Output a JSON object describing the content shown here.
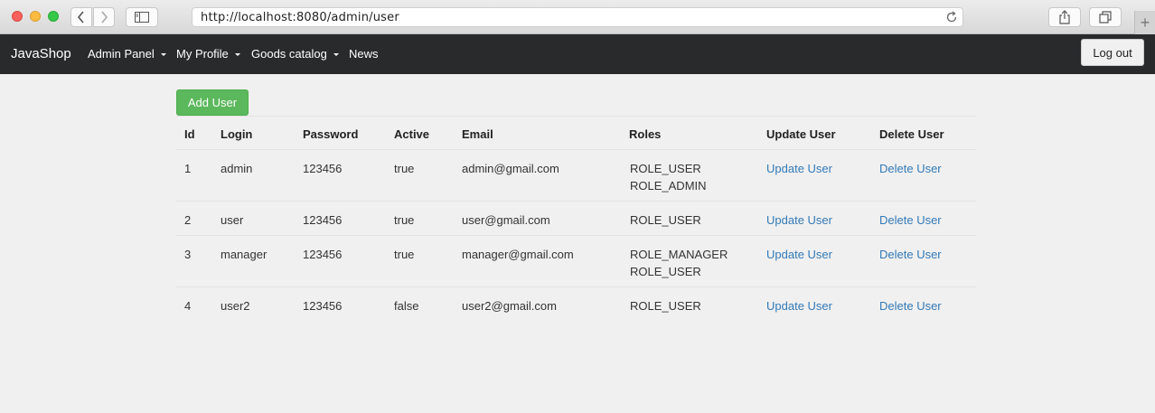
{
  "browser": {
    "url": "http://localhost:8080/admin/user",
    "icons": [
      "back-icon",
      "forward-icon",
      "sidebar-icon",
      "reload-icon",
      "share-icon",
      "tabs-icon",
      "new-tab-icon"
    ]
  },
  "navbar": {
    "brand": "JavaShop",
    "items": [
      {
        "label": "Admin Panel",
        "dropdown": true
      },
      {
        "label": "My Profile",
        "dropdown": true
      },
      {
        "label": "Goods catalog",
        "dropdown": true
      },
      {
        "label": "News",
        "dropdown": false
      }
    ],
    "logout_label": "Log out",
    "background": "#282a2c"
  },
  "main": {
    "add_user_label": "Add User",
    "add_user_color": "#5cb85c",
    "link_color": "#337ab7",
    "table": {
      "headers": [
        "Id",
        "Login",
        "Password",
        "Active",
        "Email",
        "Roles",
        "Update User",
        "Delete User"
      ],
      "rows": [
        {
          "id": "1",
          "login": "admin",
          "password": "123456",
          "active": "true",
          "email": "admin@gmail.com",
          "roles": [
            "ROLE_USER",
            "ROLE_ADMIN"
          ],
          "update": "Update User",
          "delete": "Delete User"
        },
        {
          "id": "2",
          "login": "user",
          "password": "123456",
          "active": "true",
          "email": "user@gmail.com",
          "roles": [
            "ROLE_USER"
          ],
          "update": "Update User",
          "delete": "Delete User"
        },
        {
          "id": "3",
          "login": "manager",
          "password": "123456",
          "active": "true",
          "email": "manager@gmail.com",
          "roles": [
            "ROLE_MANAGER",
            "ROLE_USER"
          ],
          "update": "Update User",
          "delete": "Delete User"
        },
        {
          "id": "4",
          "login": "user2",
          "password": "123456",
          "active": "false",
          "email": "user2@gmail.com",
          "roles": [
            "ROLE_USER"
          ],
          "update": "Update User",
          "delete": "Delete User"
        }
      ]
    }
  }
}
